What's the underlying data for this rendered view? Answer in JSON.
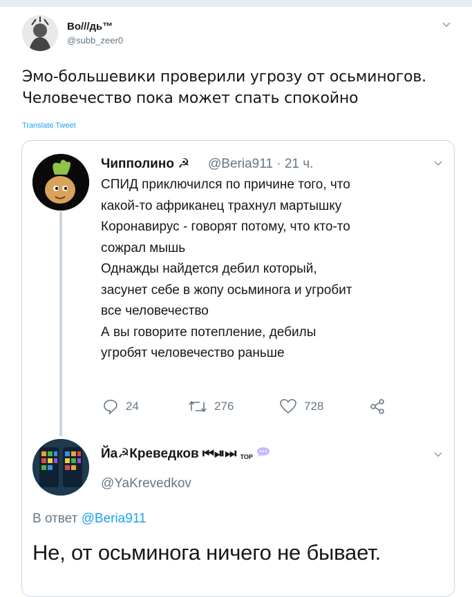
{
  "outer_tweet": {
    "display_name": "Во///дь™",
    "handle": "@subb_zeer0",
    "text": "Эмо-большевики проверили угрозу от осьминогов.\nЧеловечество пока может спать спокойно",
    "translate_label": "Translate Tweet"
  },
  "quoted_tweet": {
    "display_name": "Чипполино ☭",
    "handle": "@Beria911",
    "separator": "·",
    "time": "21 ч.",
    "text": "СПИД приключился  по причине того, что\nкакой-то африканец трахнул мартышку\nКоронавирус - говорят потому, что кто-то\nсожрал мышь\nОднажды найдется дебил который,\nзасунет себе в жопу осьминога и угробит\nвсе человечество\nА вы говорите потепление, дебилы\nугробят человечество раньше",
    "actions": {
      "reply_count": "24",
      "retweet_count": "276",
      "like_count": "728"
    }
  },
  "reply_tweet": {
    "display_name": "Йа☭Креведков ⏮⏯⏭",
    "top_badge": "TOP",
    "handle": "@YaKrevedkov",
    "in_reply_prefix": "В ответ",
    "in_reply_handle": "@Beria911",
    "text": "Не, от осьминога ничего не бывает."
  },
  "colors": {
    "link_blue": "#1da1f2",
    "muted_gray": "#657786",
    "border": "#ccd6dd"
  }
}
